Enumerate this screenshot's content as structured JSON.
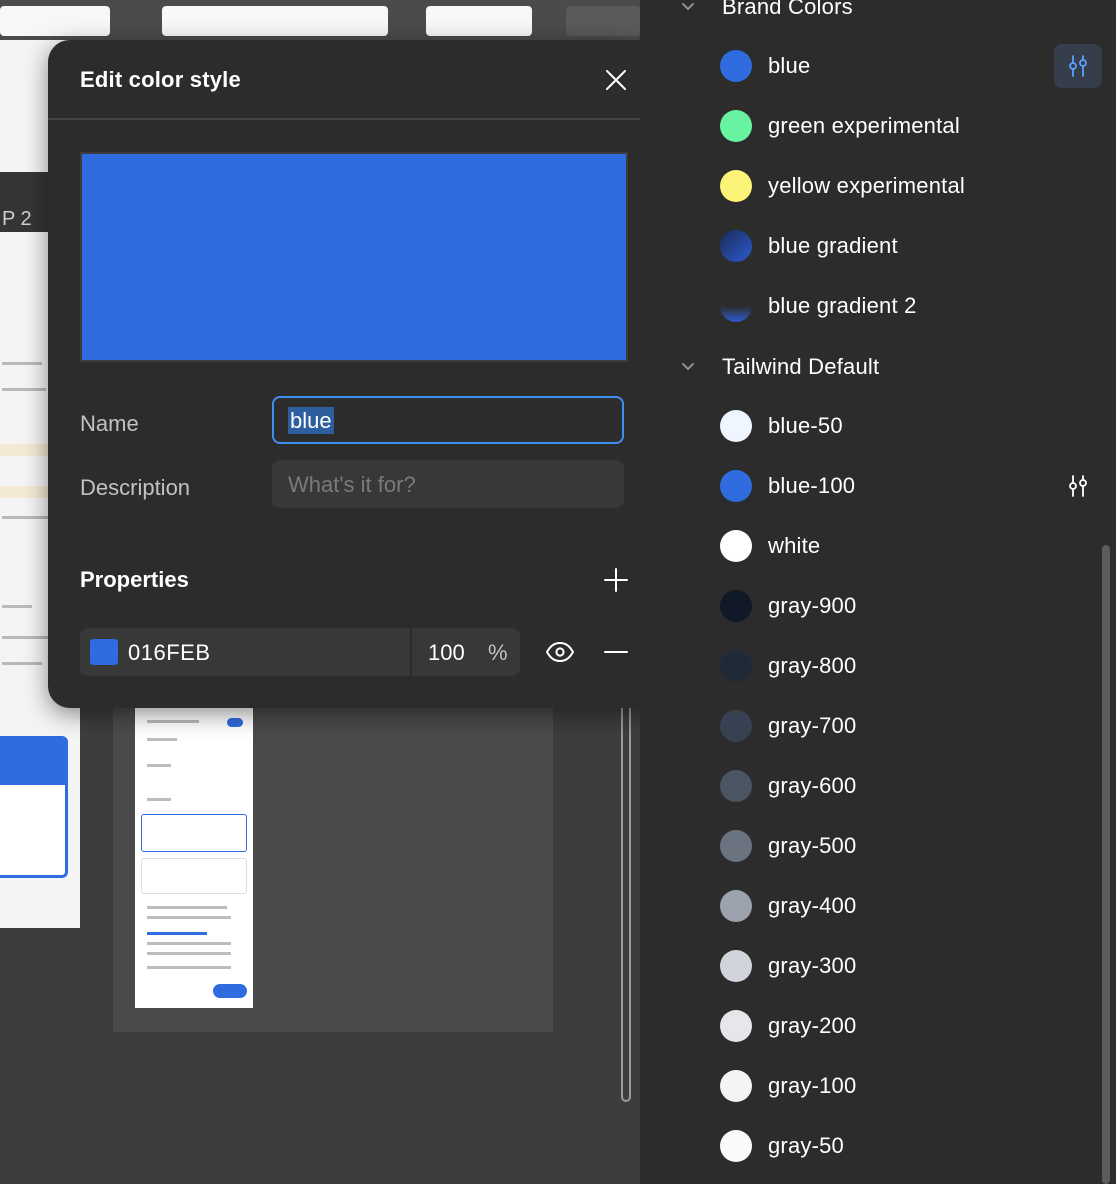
{
  "dialog": {
    "title": "Edit color style",
    "preview_color": "#2F6CE0",
    "name_label": "Name",
    "name_value": "blue",
    "description_label": "Description",
    "description_placeholder": "What's it for?",
    "properties_title": "Properties",
    "property": {
      "swatch_color": "#2F6CE0",
      "hex": "016FEB",
      "opacity": "100",
      "opacity_unit": "%"
    }
  },
  "canvas": {
    "step_label": "P 2"
  },
  "panel": {
    "groups": [
      {
        "name": "Brand Colors",
        "items": [
          {
            "label": "blue",
            "color": "#2F6CE0",
            "edit": "active"
          },
          {
            "label": "green experimental",
            "color": "#69F2A0"
          },
          {
            "label": "yellow experimental",
            "color": "#FCF476"
          },
          {
            "label": "blue gradient",
            "color": "linear-gradient(135deg, #1a2a57 0%, #2c5bd1 100%)"
          },
          {
            "label": "blue gradient 2",
            "color": "linear-gradient(180deg, rgba(44,44,44,0) 50%, #2c5bd1 100%)"
          }
        ]
      },
      {
        "name": "Tailwind Default",
        "items": [
          {
            "label": "blue-50",
            "color": "#EFF6FF"
          },
          {
            "label": "blue-100",
            "color": "#2F6CE0",
            "edit": "hover"
          },
          {
            "label": "white",
            "color": "#FFFFFF"
          },
          {
            "label": "gray-900",
            "color": "#111827"
          },
          {
            "label": "gray-800",
            "color": "#1F2937"
          },
          {
            "label": "gray-700",
            "color": "#374151"
          },
          {
            "label": "gray-600",
            "color": "#4B5563"
          },
          {
            "label": "gray-500",
            "color": "#6B7280"
          },
          {
            "label": "gray-400",
            "color": "#9CA3AF"
          },
          {
            "label": "gray-300",
            "color": "#D1D5DB"
          },
          {
            "label": "gray-200",
            "color": "#E5E7EB"
          },
          {
            "label": "gray-100",
            "color": "#F3F4F6"
          },
          {
            "label": "gray-50",
            "color": "#F9FAFB"
          }
        ]
      }
    ]
  }
}
